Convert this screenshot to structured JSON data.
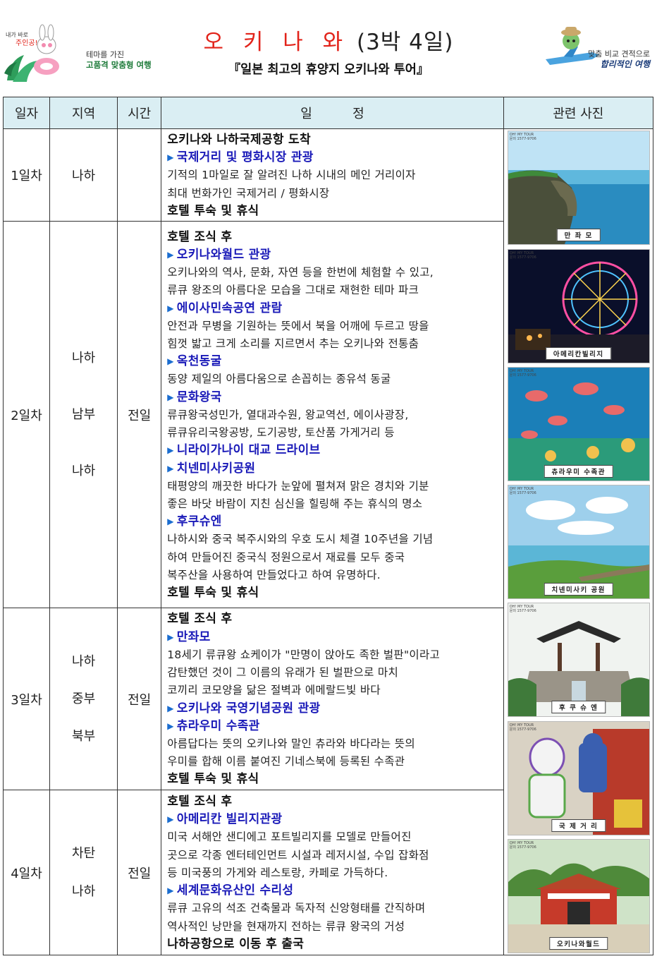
{
  "header": {
    "left_logo_text": "테마를 가진",
    "left_logo_text_bold": "고품격 맞춤형 여행",
    "title_main": "오 키 나 와",
    "title_suffix": "(3박 4일)",
    "subtitle": "『일본 최고의 휴양지 오키나와 투어』",
    "right_logo_text": "맞춤 비교 견적으로",
    "right_logo_text_bold": "합리적인 여행"
  },
  "table": {
    "headers": [
      "일자",
      "지역",
      "시간",
      "일          정",
      "관련 사진"
    ],
    "days": [
      {
        "day": "1일차",
        "regions": [
          "나하"
        ],
        "time": "",
        "lines": [
          {
            "t": "bold",
            "text": "오키나와 나하국제공항 도착"
          },
          {
            "t": "head",
            "text": "국제거리 및 평화시장 관광"
          },
          {
            "t": "desc",
            "text": "기적의 1마일로 잘 알려진 나하 시내의 메인 거리이자"
          },
          {
            "t": "desc",
            "text": "최대 번화가인 국제거리 / 평화시장"
          },
          {
            "t": "bold",
            "text": "호텔 투숙 및 휴식"
          }
        ]
      },
      {
        "day": "2일차",
        "regions": [
          "나하",
          "남부",
          "나하"
        ],
        "time": "전일",
        "lines": [
          {
            "t": "bold",
            "text": "호텔 조식 후"
          },
          {
            "t": "head",
            "text": "오키나와월드 관광"
          },
          {
            "t": "desc",
            "text": "오키나와의 역사, 문화, 자연 등을 한번에 체험할 수 있고,"
          },
          {
            "t": "desc",
            "text": "류큐 왕조의 아름다운 모습을 그대로 재현한 테마 파크"
          },
          {
            "t": "head",
            "text": "에이사민속공연 관람"
          },
          {
            "t": "desc",
            "text": "안전과 무병을 기원하는 뜻에서 북을 어깨에 두르고 땅을"
          },
          {
            "t": "desc",
            "text": "힘껏 밟고 크게 소리를 지르면서 추는 오키나와 전통춤"
          },
          {
            "t": "head",
            "text": "옥천동굴"
          },
          {
            "t": "desc",
            "text": "동양 제일의 아름다움으로 손꼽히는 종유석 동굴"
          },
          {
            "t": "head",
            "text": "문화왕국"
          },
          {
            "t": "desc",
            "text": "류큐왕국성민가, 열대과수원, 왕교역선, 에이사광장,"
          },
          {
            "t": "desc",
            "text": "류큐유리국왕공방, 도기공방, 토산품 가게거리 등"
          },
          {
            "t": "head",
            "text": "니라이가나이 대교 드라이브"
          },
          {
            "t": "head",
            "text": "치넨미사키공원"
          },
          {
            "t": "desc",
            "text": "태평양의 깨끗한 바다가 눈앞에 펼쳐져 맑은 경치와 기분"
          },
          {
            "t": "desc",
            "text": "좋은 바닷 바람이 지친 심신을 힐링해 주는 휴식의 명소"
          },
          {
            "t": "head",
            "text": "후쿠슈엔"
          },
          {
            "t": "desc",
            "text": "나하시와 중국 복주시와의 우호 도시 체결 10주년을 기념"
          },
          {
            "t": "desc",
            "text": "하여 만들어진 중국식 정원으로서 재료를 모두 중국"
          },
          {
            "t": "desc",
            "text": "복주산을 사용하여 만들었다고 하여 유명하다."
          },
          {
            "t": "bold",
            "text": "호텔 투숙 및 휴식"
          }
        ]
      },
      {
        "day": "3일차",
        "regions": [
          "나하",
          "중부",
          "북부"
        ],
        "time": "전일",
        "lines": [
          {
            "t": "bold",
            "text": "호텔 조식 후"
          },
          {
            "t": "head",
            "text": "만좌모"
          },
          {
            "t": "desc",
            "text": "18세기 류큐왕 쇼케이가 \"만명이 앉아도 족한 벌판\"이라고"
          },
          {
            "t": "desc",
            "text": "감탄했던 것이 그 이름의 유래가 된 벌판으로 마치"
          },
          {
            "t": "desc",
            "text": "코끼리 코모양을 닮은 절벽과 에메랄드빛 바다"
          },
          {
            "t": "head",
            "text": "오키나와 국영기념공원 관광"
          },
          {
            "t": "head",
            "text": "츄라우미 수족관"
          },
          {
            "t": "desc",
            "text": "아름답다는 뜻의 오키나와 말인 츄라와 바다라는 뜻의"
          },
          {
            "t": "desc",
            "text": "우미를 합해 이름 붙여진 기네스북에 등록된 수족관"
          },
          {
            "t": "bold",
            "text": "호텔 투숙 및 휴식"
          }
        ]
      },
      {
        "day": "4일차",
        "regions": [
          "차탄",
          "나하"
        ],
        "time": "전일",
        "lines": [
          {
            "t": "bold",
            "text": "호텔 조식 후"
          },
          {
            "t": "head",
            "text": "아메리칸 빌리지관광"
          },
          {
            "t": "desc",
            "text": "미국 서해안 샌디에고 포트빌리지를 모델로 만들어진"
          },
          {
            "t": "desc",
            "text": "곳으로 각종 엔터테인먼트 시설과 레저시설, 수입 잡화점"
          },
          {
            "t": "desc",
            "text": "등 미국풍의 가게와 레스토랑, 카페로 가득하다."
          },
          {
            "t": "head",
            "text": "세계문화유산인 수리성"
          },
          {
            "t": "desc",
            "text": "류큐 고유의 석조 건축물과 독자적 신앙형태를 간직하며"
          },
          {
            "t": "desc",
            "text": "역사적인 낭만을 현재까지 전하는 류큐 왕국의 거성"
          },
          {
            "t": "bold",
            "text": "나하공항으로 이동 후 출국"
          }
        ]
      }
    ]
  },
  "photos": [
    {
      "caption": "만 좌 모",
      "icon": "cliff-sea-photo",
      "badge_title": "OH! MY TOUR",
      "badge_phone": "문의 1577-9706"
    },
    {
      "caption": "아메리칸빌리지",
      "icon": "ferris-wheel-photo",
      "badge_title": "OH! MY TOUR",
      "badge_phone": "문의 1577-9706"
    },
    {
      "caption": "츄라우미 수족관",
      "icon": "aquarium-fish-photo",
      "badge_title": "OH! MY TOUR",
      "badge_phone": "문의 1577-9706"
    },
    {
      "caption": "치넨미사키 공원",
      "icon": "cape-park-photo",
      "badge_title": "OH! MY TOUR",
      "badge_phone": "문의 1577-9706"
    },
    {
      "caption": "후 쿠 슈 엔",
      "icon": "chinese-pavilion-photo",
      "badge_title": "OH! MY TOUR",
      "badge_phone": "문의 1577-9706"
    },
    {
      "caption": "국 제 거 리",
      "icon": "toy-figures-photo",
      "badge_title": "OH! MY TOUR",
      "badge_phone": "문의 1577-9706"
    },
    {
      "caption": "오키나와월드",
      "icon": "red-gate-photo",
      "badge_title": "OH! MY TOUR",
      "badge_phone": "문의 1577-9706"
    }
  ],
  "colors": {
    "title_red": "#e2231a",
    "heading_blue": "#1a1ab8",
    "header_bg": "#daeef3"
  }
}
